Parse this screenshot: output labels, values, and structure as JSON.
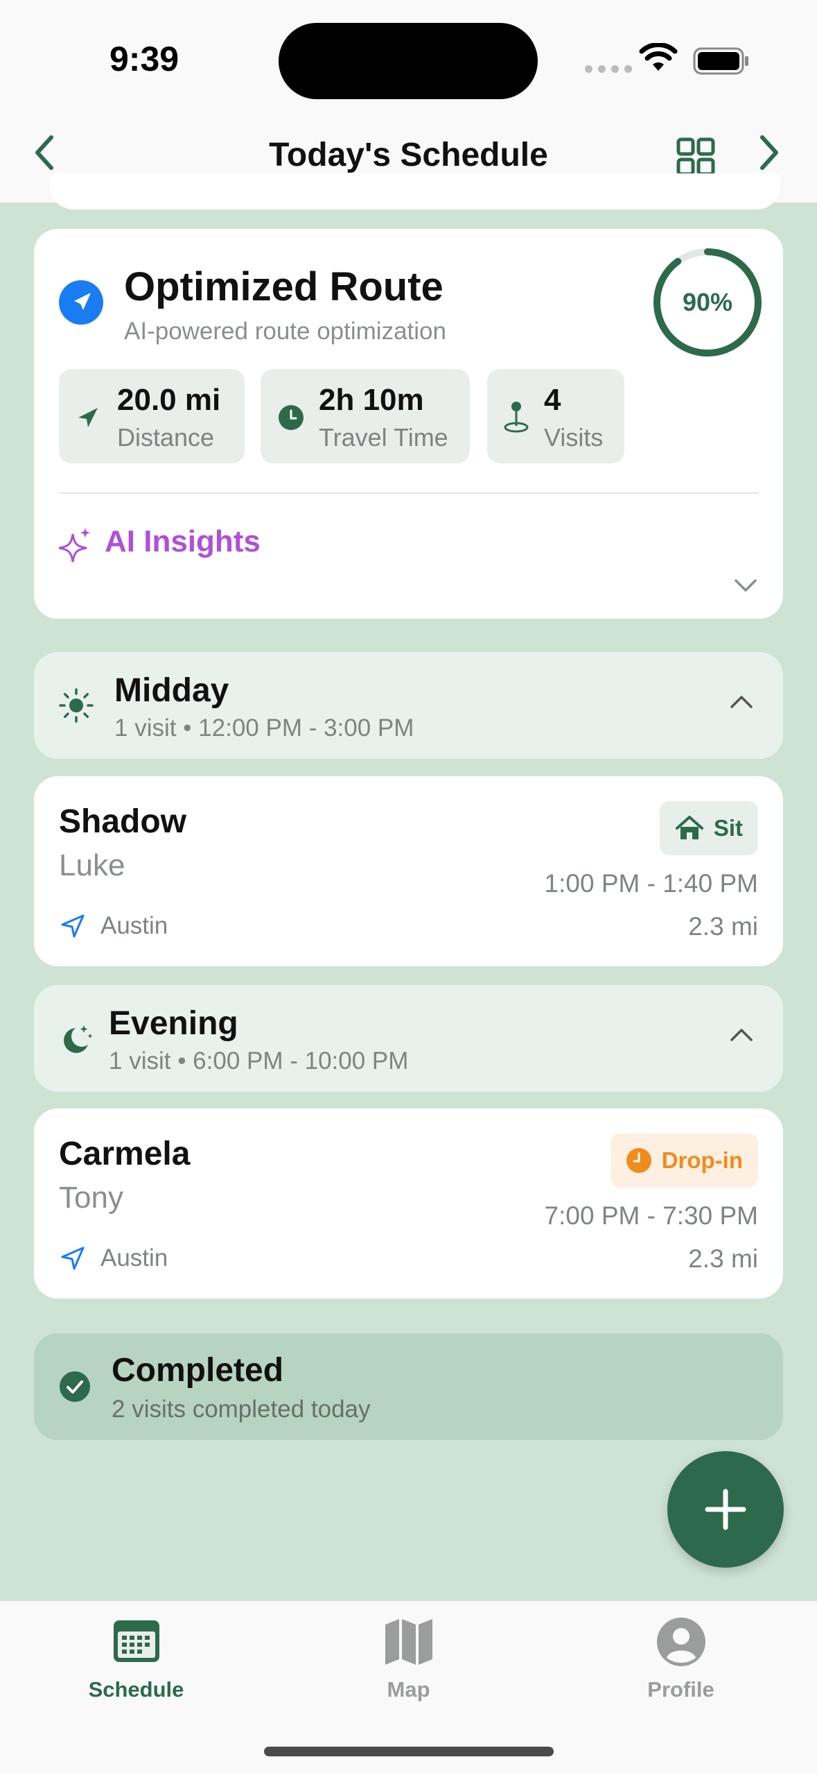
{
  "status": {
    "time": "9:39"
  },
  "nav": {
    "title": "Today's Schedule"
  },
  "route": {
    "title": "Optimized Route",
    "subtitle": "AI-powered route optimization",
    "score_label": "90%",
    "score_fraction": 0.9,
    "stats": [
      {
        "value": "20.0 mi",
        "label": "Distance",
        "icon": "navigation-arrow-icon"
      },
      {
        "value": "2h 10m",
        "label": "Travel Time",
        "icon": "clock-icon"
      },
      {
        "value": "4",
        "label": "Visits",
        "icon": "map-pin-icon"
      }
    ],
    "insights_label": "AI Insights"
  },
  "sections": [
    {
      "title": "Midday",
      "meta": "1 visit • 12:00 PM - 3:00 PM",
      "icon": "sun-icon"
    },
    {
      "title": "Evening",
      "meta": "1 visit • 6:00 PM - 10:00 PM",
      "icon": "moon-stars-icon"
    }
  ],
  "visits": [
    {
      "pet": "Shadow",
      "owner": "Luke",
      "badge": "Sit",
      "time": "1:00 PM - 1:40 PM",
      "location": "Austin",
      "distance": "2.3 mi"
    },
    {
      "pet": "Carmela",
      "owner": "Tony",
      "badge": "Drop-in",
      "time": "7:00 PM - 7:30 PM",
      "location": "Austin",
      "distance": "2.3 mi"
    }
  ],
  "completed": {
    "title": "Completed",
    "meta": "2 visits completed today"
  },
  "tabs": [
    {
      "label": "Schedule",
      "icon": "calendar-icon"
    },
    {
      "label": "Map",
      "icon": "map-icon"
    },
    {
      "label": "Profile",
      "icon": "person-icon"
    }
  ],
  "colors": {
    "accent": "#2d6a4b",
    "ai": "#b04fd8",
    "dropin": "#f08c1e",
    "link": "#1a7cf2",
    "background": "#cfe3d4"
  }
}
